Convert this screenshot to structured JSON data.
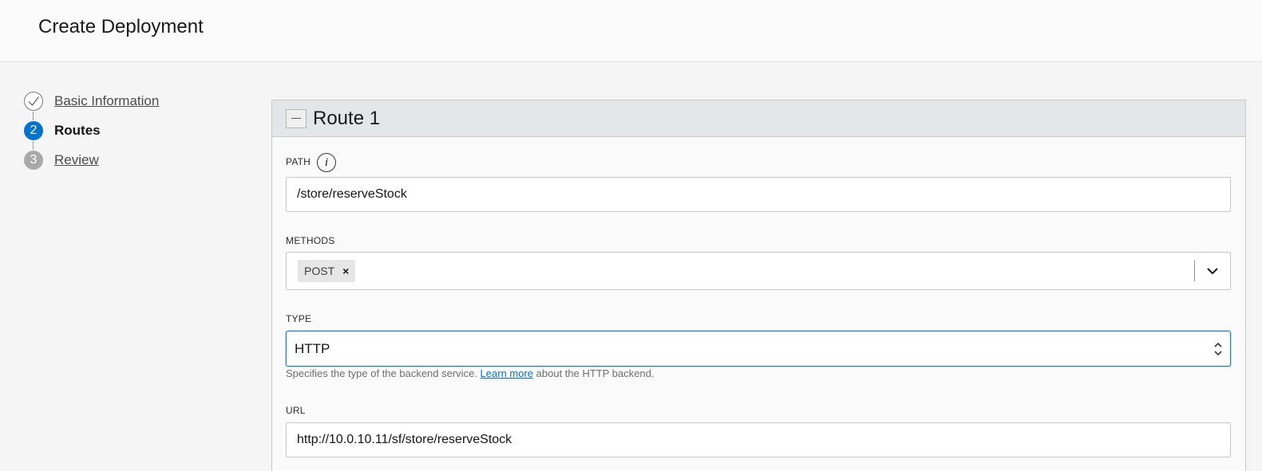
{
  "header": {
    "title": "Create Deployment"
  },
  "wizard": {
    "steps": [
      {
        "marker": "✓",
        "label": "Basic Information",
        "state": "complete"
      },
      {
        "marker": "2",
        "label": "Routes",
        "state": "current"
      },
      {
        "marker": "3",
        "label": "Review",
        "state": "future"
      }
    ]
  },
  "route": {
    "title": "Route 1",
    "collapse_icon": "minus-icon",
    "path": {
      "label": "PATH",
      "info_icon": "i",
      "value": "/store/reserveStock"
    },
    "methods": {
      "label": "METHODS",
      "chips": [
        "POST"
      ],
      "remove_glyph": "×",
      "dropdown_icon": "chevron-down-icon"
    },
    "type": {
      "label": "TYPE",
      "value": "HTTP",
      "helper_prefix": "Specifies the type of the backend service.",
      "helper_link": "Learn more",
      "helper_suffix": "about the HTTP backend."
    },
    "url": {
      "label": "URL",
      "value": "http://10.0.10.11/sf/store/reserveStock"
    }
  },
  "colors": {
    "accent": "#0572ce",
    "focus_border": "#1b7cd4",
    "header_band": "#e3e5e8"
  }
}
